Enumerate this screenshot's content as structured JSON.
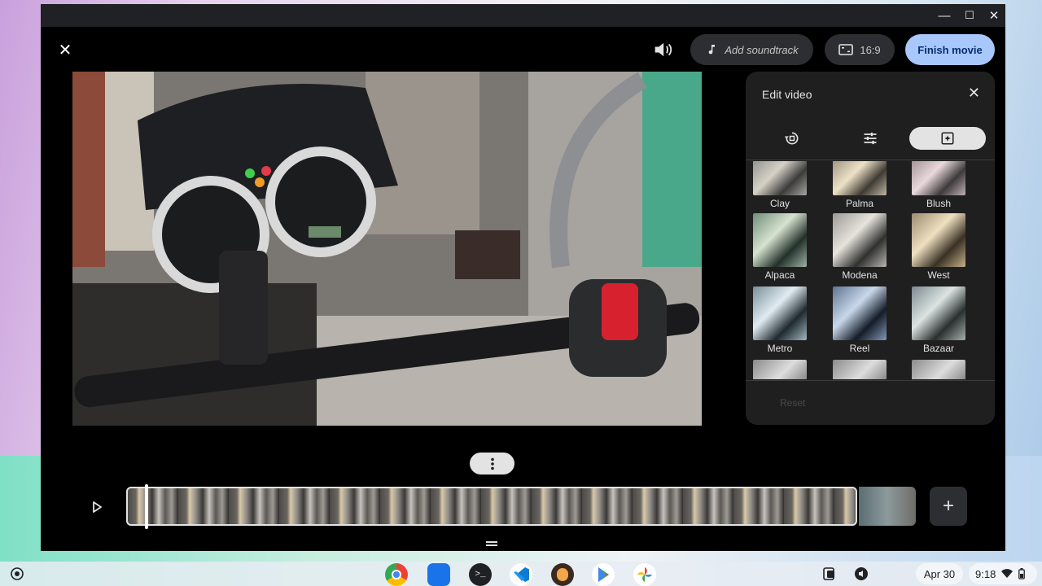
{
  "window": {
    "controls": {
      "minimize": "—",
      "maximize": "☐",
      "close": "✕"
    }
  },
  "toolbar": {
    "close_label": "✕",
    "add_soundtrack_label": "Add soundtrack",
    "aspect_ratio_label": "16:9",
    "finish_movie_label": "Finish movie"
  },
  "edit_panel": {
    "title": "Edit video",
    "close_label": "✕",
    "tabs": [
      {
        "icon": "rotate-icon",
        "active": false
      },
      {
        "icon": "adjust-sliders-icon",
        "active": false
      },
      {
        "icon": "filters-icon",
        "active": true
      }
    ],
    "filters": [
      {
        "label": "Clay"
      },
      {
        "label": "Palma"
      },
      {
        "label": "Blush"
      },
      {
        "label": "Alpaca"
      },
      {
        "label": "Modena"
      },
      {
        "label": "West"
      },
      {
        "label": "Metro"
      },
      {
        "label": "Reel"
      },
      {
        "label": "Bazaar"
      }
    ],
    "reset_label": "Reset"
  },
  "timeline": {
    "add_clip_label": "+"
  },
  "shelf": {
    "apps": [
      "chrome-icon",
      "files-icon",
      "terminal-icon",
      "vscode-icon",
      "app-icon",
      "play-store-icon",
      "photos-icon"
    ],
    "date": "Apr 30",
    "time": "9:18"
  }
}
